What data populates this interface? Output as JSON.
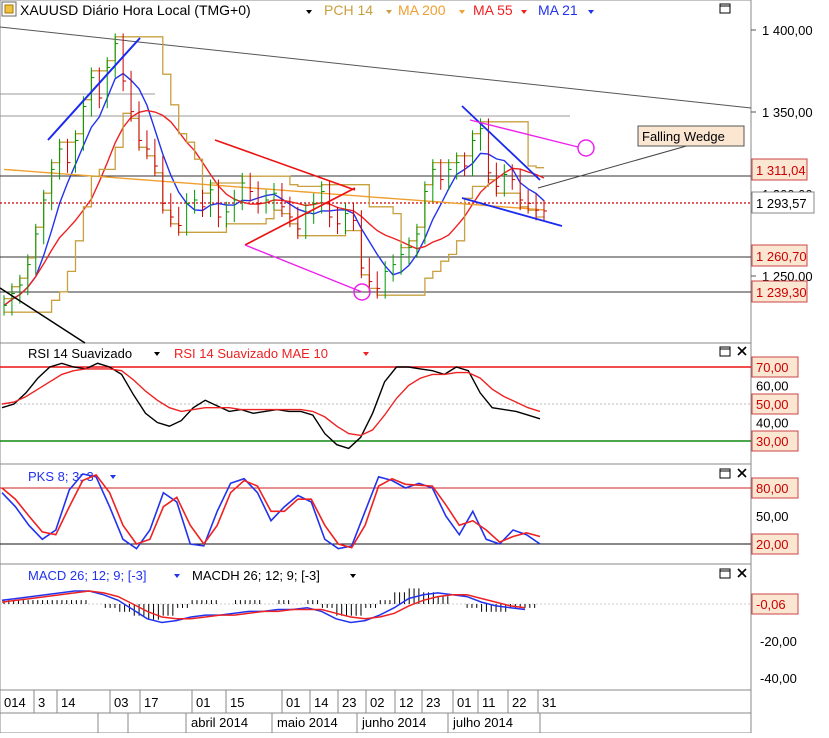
{
  "main": {
    "symbol_title": "XAUUSD Diário Hora Local (TMG+0)",
    "legend": [
      {
        "label": "PCH 14",
        "color": "#c8a040"
      },
      {
        "label": "MA 200",
        "color": "#f0a030"
      },
      {
        "label": "MA 55",
        "color": "#ee2222"
      },
      {
        "label": "MA 21",
        "color": "#2233ee"
      }
    ],
    "annotation": "Falling Wedge"
  },
  "rsi": {
    "title": "RSI 14 Suavizado",
    "title2": "RSI 14 Suavizado MAE 10"
  },
  "pks": {
    "title": "PKS 8; 3; 3"
  },
  "macd": {
    "title": "MACD 26; 12; 9; [-3]",
    "title2": "MACDH 26; 12; 9; [-3]"
  },
  "axis": {
    "months": [
      "abril 2014",
      "maio 2014",
      "junho 2014",
      "julho 2014"
    ]
  },
  "chart_data": [
    {
      "type": "line",
      "panel": "price",
      "title": "XAUUSD Diário Hora Local (TMG+0)",
      "y_ticks": [
        "1 400,00",
        "1 350,00",
        "1 300,00",
        "1 250,00"
      ],
      "ylim": [
        1200,
        1420
      ],
      "price_labels": [
        {
          "value": "1 311,04",
          "role": "level"
        },
        {
          "value": "1 293,57",
          "role": "last"
        },
        {
          "value": "1 260,70",
          "role": "level"
        },
        {
          "value": "1 239,30",
          "role": "level"
        }
      ],
      "x_ticks": [
        "014",
        "3",
        "14",
        "03",
        "17",
        "01",
        "15",
        "01",
        "14",
        "23",
        "02",
        "12",
        "23",
        "01",
        "11",
        "22",
        "31"
      ],
      "close": [
        1238,
        1245,
        1250,
        1262,
        1280,
        1300,
        1318,
        1330,
        1322,
        1335,
        1355,
        1372,
        1360,
        1378,
        1392,
        1370,
        1352,
        1335,
        1330,
        1320,
        1298,
        1290,
        1285,
        1298,
        1300,
        1296,
        1306,
        1290,
        1293,
        1300,
        1310,
        1305,
        1298,
        1300,
        1304,
        1296,
        1290,
        1283,
        1292,
        1298,
        1305,
        1290,
        1286,
        1292,
        1288,
        1260,
        1252,
        1248,
        1258,
        1262,
        1268,
        1272,
        1280,
        1305,
        1318,
        1312,
        1318,
        1322,
        1320,
        1335,
        1342,
        1316,
        1308,
        1315,
        1312,
        1300,
        1298,
        1294,
        1293.57
      ],
      "series": [
        {
          "name": "PCH 14",
          "color": "#c8a040"
        },
        {
          "name": "MA 200",
          "color": "#f0a030"
        },
        {
          "name": "MA 55",
          "color": "#ee2222"
        },
        {
          "name": "MA 21",
          "color": "#2233ee"
        }
      ]
    },
    {
      "type": "line",
      "panel": "rsi",
      "title": "RSI 14 Suavizado",
      "y_ticks": [
        "70,00",
        "60,00",
        "50,00",
        "40,00",
        "30,00"
      ],
      "levels": [
        70,
        30
      ],
      "ylim": [
        20,
        78
      ],
      "series": [
        {
          "name": "RSI 14 Suavizado",
          "color": "#000000",
          "values": [
            48,
            50,
            56,
            64,
            70,
            72,
            70,
            69,
            72,
            70,
            66,
            55,
            45,
            40,
            38,
            41,
            48,
            52,
            49,
            46,
            47,
            45,
            46,
            47,
            46,
            46,
            44,
            34,
            28,
            26,
            32,
            45,
            62,
            70,
            70,
            69,
            68,
            66,
            70,
            68,
            56,
            48,
            47,
            46,
            44,
            42
          ]
        },
        {
          "name": "RSI 14 Suavizado MAE 10",
          "color": "#ee2222",
          "values": [
            50,
            51,
            54,
            58,
            62,
            66,
            68,
            69,
            69,
            69,
            68,
            63,
            57,
            52,
            48,
            46,
            47,
            48,
            48,
            48,
            47,
            47,
            47,
            47,
            47,
            47,
            46,
            43,
            38,
            34,
            33,
            36,
            44,
            53,
            60,
            64,
            66,
            66,
            67,
            67,
            64,
            58,
            54,
            51,
            48,
            46
          ]
        }
      ]
    },
    {
      "type": "line",
      "panel": "pks",
      "title": "PKS 8; 3; 3",
      "y_ticks": [
        "80,00",
        "50,00",
        "20,00"
      ],
      "levels": [
        80,
        20
      ],
      "ylim": [
        0,
        100
      ],
      "series": [
        {
          "name": "%K",
          "color": "#2233ee",
          "values": [
            75,
            60,
            40,
            25,
            35,
            78,
            95,
            92,
            60,
            25,
            15,
            35,
            75,
            65,
            20,
            18,
            55,
            85,
            90,
            75,
            45,
            60,
            72,
            65,
            25,
            15,
            18,
            55,
            92,
            88,
            80,
            85,
            80,
            50,
            30,
            55,
            25,
            20,
            35,
            30,
            20
          ]
        },
        {
          "name": "%D",
          "color": "#ee2222",
          "values": [
            80,
            68,
            50,
            33,
            30,
            60,
            88,
            94,
            75,
            40,
            20,
            25,
            60,
            70,
            40,
            20,
            40,
            75,
            88,
            82,
            55,
            55,
            68,
            68,
            40,
            20,
            16,
            40,
            82,
            90,
            84,
            83,
            82,
            62,
            40,
            45,
            35,
            22,
            28,
            32,
            28
          ]
        }
      ]
    },
    {
      "type": "bar",
      "panel": "macd",
      "title": "MACD 26; 12; 9; [-3]",
      "y_ticks": [
        "-20,00",
        "-40,00"
      ],
      "price_labels": [
        {
          "value": "-0,06",
          "role": "last"
        }
      ],
      "ylim": [
        -48,
        8
      ],
      "series": [
        {
          "name": "MACD",
          "color": "#2233ee",
          "values": [
            2,
            3,
            4,
            5,
            6,
            7,
            7,
            5,
            2,
            -3,
            -8,
            -10,
            -9,
            -7,
            -6,
            -6,
            -5,
            -4,
            -4,
            -3,
            -3,
            -2,
            -4,
            -8,
            -10,
            -9,
            -6,
            -2,
            3,
            5,
            6,
            5,
            4,
            1,
            -1,
            -2,
            -3
          ]
        },
        {
          "name": "Signal",
          "color": "#ee2222",
          "values": [
            1,
            2,
            3,
            4,
            5,
            6,
            7,
            6,
            4,
            0,
            -4,
            -7,
            -8,
            -8,
            -7,
            -6,
            -6,
            -5,
            -4,
            -4,
            -3,
            -3,
            -3,
            -5,
            -7,
            -8,
            -7,
            -5,
            -1,
            2,
            4,
            5,
            5,
            3,
            1,
            -1,
            -2
          ]
        },
        {
          "name": "MACDH",
          "color": "#000000",
          "values": [
            1,
            1,
            1,
            1,
            1,
            1,
            0,
            -1,
            -2,
            -3,
            -4,
            -3,
            -1,
            1,
            1,
            0,
            1,
            1,
            0,
            1,
            0,
            1,
            -1,
            -3,
            -3,
            -1,
            1,
            3,
            4,
            3,
            2,
            0,
            -1,
            -2,
            -2,
            -1,
            -1
          ]
        }
      ]
    }
  ]
}
